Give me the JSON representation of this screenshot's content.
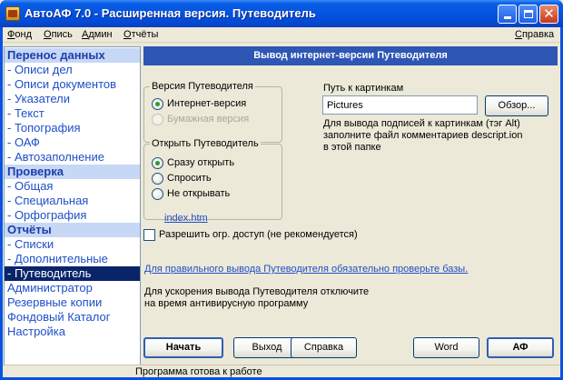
{
  "window": {
    "title": "АвтоАФ 7.0 - Расширенная версия. Путеводитель"
  },
  "menu": {
    "items": [
      {
        "key": "Ф",
        "rest": "онд"
      },
      {
        "key": "О",
        "rest": "пись"
      },
      {
        "key": "А",
        "rest": "дмин"
      },
      {
        "key": "О",
        "rest": "тчёты"
      }
    ],
    "help": {
      "key": "С",
      "rest": "правка"
    }
  },
  "sidebar": {
    "sections": [
      {
        "title": "Перенос данных",
        "items": [
          "- Описи дел",
          "- Описи документов",
          "- Указатели",
          "- Текст",
          "- Топография",
          "- ОАФ",
          "- Автозаполнение"
        ]
      },
      {
        "title": "Проверка",
        "items": [
          "- Общая",
          "- Специальная",
          "- Орфография"
        ]
      },
      {
        "title": "Отчёты",
        "items": [
          "- Списки",
          "- Дополнительные",
          "- Путеводитель"
        ]
      }
    ],
    "extra_items": [
      "Администратор",
      "Резервные копии",
      "Фондовый Каталог",
      "Настройка"
    ]
  },
  "main": {
    "banner": "Вывод интернет-версии Путеводителя",
    "version_group": {
      "title": "Версия Путеводителя",
      "options": [
        "Интернет-версия",
        "Бумажная версия"
      ]
    },
    "open_group": {
      "title": "Открыть Путеводитель",
      "options": [
        "Сразу открыть",
        "Спросить",
        "Не открывать"
      ]
    },
    "pictures": {
      "label": "Путь к картинкам",
      "value": "Pictures",
      "browse_label": "Обзор...",
      "hint_1": "Для вывода подписей к картинкам (тэг Alt)",
      "hint_2": "заполните файл комментариев descript.ion",
      "hint_3": "в этой папке"
    },
    "index_link": "index.htm",
    "access_checkbox": "Разрешить огр. доступ (не рекомендуется)",
    "warning_link": "Для правильного вывода Путеводителя обязательно проверьте базы.",
    "antivirus_1": "Для ускорения вывода Путеводителя отключите",
    "antivirus_2": "на время антивирусную программу",
    "buttons": {
      "start": "Начать",
      "exit": "Выход",
      "help": "Справка",
      "word": "Word",
      "af": "АФ"
    }
  },
  "status": {
    "text": "Программа готова к работе"
  }
}
